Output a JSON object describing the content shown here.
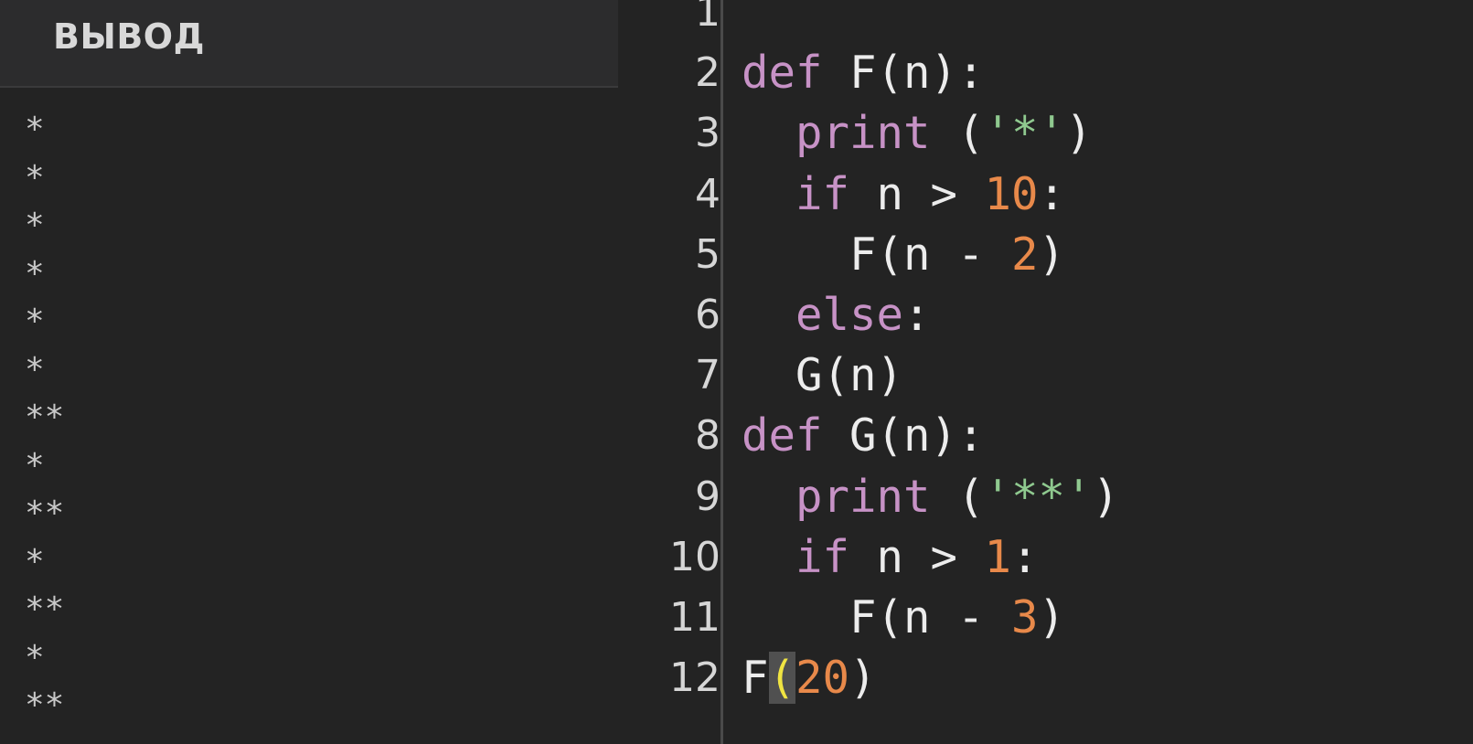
{
  "output": {
    "title": "ВЫВОД",
    "lines": [
      "*",
      "*",
      "*",
      "*",
      "*",
      "*",
      "**",
      "*",
      "**",
      "*",
      "**",
      "*",
      "**"
    ]
  },
  "editor": {
    "lines": [
      {
        "number": "1",
        "tokens": []
      },
      {
        "number": "2",
        "tokens": [
          {
            "t": "kw",
            "v": "def"
          },
          {
            "t": "txt",
            "v": " F(n):"
          }
        ]
      },
      {
        "number": "3",
        "tokens": [
          {
            "t": "txt",
            "v": "  "
          },
          {
            "t": "kw",
            "v": "print"
          },
          {
            "t": "txt",
            "v": " ("
          },
          {
            "t": "str",
            "v": "'*'"
          },
          {
            "t": "txt",
            "v": ")"
          }
        ]
      },
      {
        "number": "4",
        "tokens": [
          {
            "t": "txt",
            "v": "  "
          },
          {
            "t": "kw",
            "v": "if"
          },
          {
            "t": "txt",
            "v": " n > "
          },
          {
            "t": "num",
            "v": "10"
          },
          {
            "t": "txt",
            "v": ":"
          }
        ]
      },
      {
        "number": "5",
        "tokens": [
          {
            "t": "txt",
            "v": "    F(n - "
          },
          {
            "t": "num",
            "v": "2"
          },
          {
            "t": "txt",
            "v": ")"
          }
        ]
      },
      {
        "number": "6",
        "tokens": [
          {
            "t": "txt",
            "v": "  "
          },
          {
            "t": "kw",
            "v": "else"
          },
          {
            "t": "txt",
            "v": ":"
          }
        ]
      },
      {
        "number": "7",
        "tokens": [
          {
            "t": "txt",
            "v": "  G(n)"
          }
        ]
      },
      {
        "number": "8",
        "tokens": [
          {
            "t": "kw",
            "v": "def"
          },
          {
            "t": "txt",
            "v": " G(n):"
          }
        ]
      },
      {
        "number": "9",
        "tokens": [
          {
            "t": "txt",
            "v": "  "
          },
          {
            "t": "kw",
            "v": "print"
          },
          {
            "t": "txt",
            "v": " ("
          },
          {
            "t": "str",
            "v": "'**'"
          },
          {
            "t": "txt",
            "v": ")"
          }
        ]
      },
      {
        "number": "10",
        "tokens": [
          {
            "t": "txt",
            "v": "  "
          },
          {
            "t": "kw",
            "v": "if"
          },
          {
            "t": "txt",
            "v": " n > "
          },
          {
            "t": "num",
            "v": "1"
          },
          {
            "t": "txt",
            "v": ":"
          }
        ]
      },
      {
        "number": "11",
        "tokens": [
          {
            "t": "txt",
            "v": "    F(n - "
          },
          {
            "t": "num",
            "v": "3"
          },
          {
            "t": "txt",
            "v": ")"
          }
        ]
      },
      {
        "number": "12",
        "tokens": [
          {
            "t": "txt",
            "v": "F"
          },
          {
            "t": "cursor-paren",
            "v": "("
          },
          {
            "t": "num",
            "v": "20"
          },
          {
            "t": "txt",
            "v": ")"
          }
        ]
      }
    ]
  },
  "colors": {
    "keyword": "#c792c6",
    "string": "#8fc98f",
    "number": "#e8894a",
    "text": "#ececec",
    "background": "#232323"
  }
}
